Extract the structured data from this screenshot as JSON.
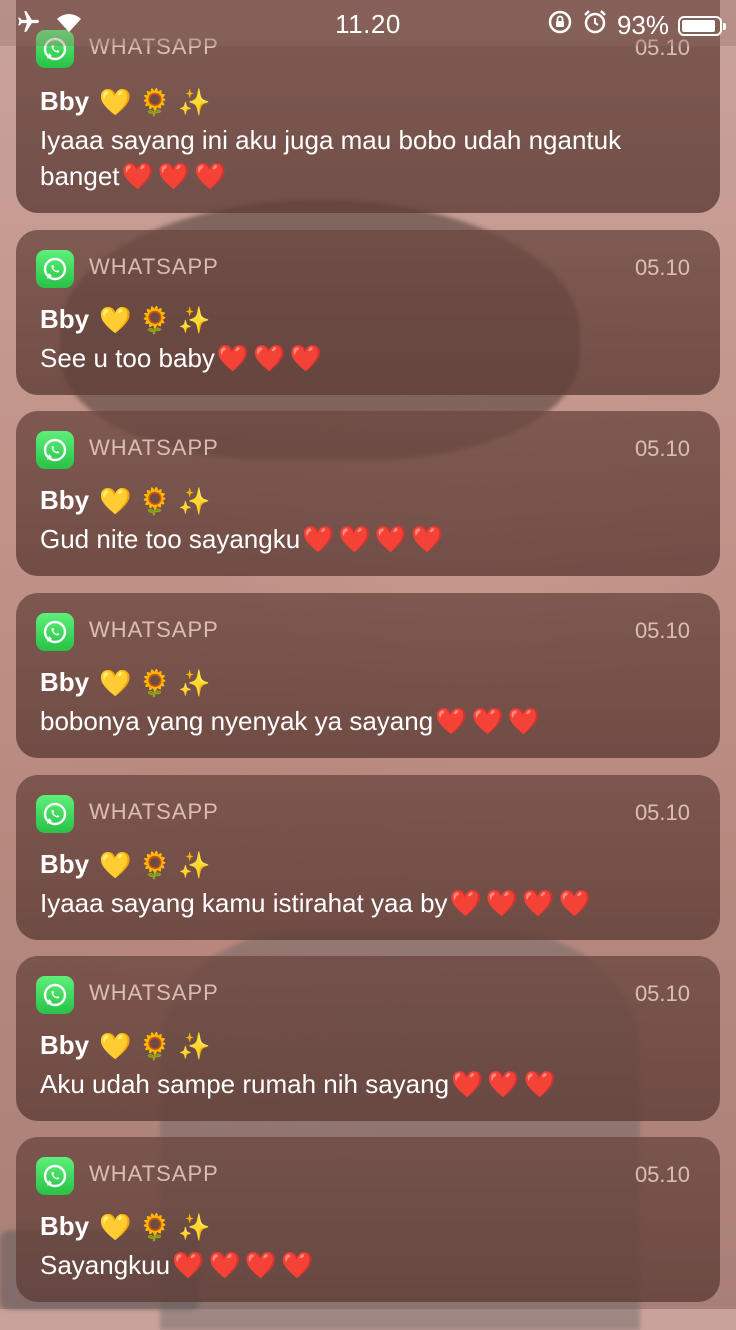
{
  "status_bar": {
    "time": "11.20",
    "battery_percent": "93%",
    "battery_level": 0.93,
    "icons": [
      "airplane-icon",
      "wifi-icon",
      "rotation-lock-icon",
      "alarm-icon",
      "battery-icon"
    ]
  },
  "notifications": [
    {
      "app": "WHATSAPP",
      "time": "05.10",
      "sender": "Bby",
      "sender_emoji": "💛 🌻 ✨",
      "message": "Iyaaa sayang ini aku juga mau bobo udah ngantuk banget",
      "hearts": "❤️❤️❤️"
    },
    {
      "app": "WHATSAPP",
      "time": "05.10",
      "sender": "Bby",
      "sender_emoji": "💛 🌻 ✨",
      "message": "See u too baby",
      "hearts": "❤️❤️❤️"
    },
    {
      "app": "WHATSAPP",
      "time": "05.10",
      "sender": "Bby",
      "sender_emoji": "💛 🌻 ✨",
      "message": "Gud nite too sayangku",
      "hearts": "❤️❤️❤️❤️"
    },
    {
      "app": "WHATSAPP",
      "time": "05.10",
      "sender": "Bby",
      "sender_emoji": "💛 🌻 ✨",
      "message": "bobonya yang nyenyak ya sayang",
      "hearts": "❤️❤️❤️"
    },
    {
      "app": "WHATSAPP",
      "time": "05.10",
      "sender": "Bby",
      "sender_emoji": "💛 🌻 ✨",
      "message": "Iyaaa sayang kamu istirahat yaa by",
      "hearts": "❤️❤️❤️❤️"
    },
    {
      "app": "WHATSAPP",
      "time": "05.10",
      "sender": "Bby",
      "sender_emoji": "💛 🌻 ✨",
      "message": "Aku udah sampe rumah nih sayang",
      "hearts": "❤️❤️❤️"
    },
    {
      "app": "WHATSAPP",
      "time": "05.10",
      "sender": "Bby",
      "sender_emoji": "💛 🌻 ✨",
      "message": "Sayangkuu",
      "hearts": "❤️❤️❤️❤️"
    }
  ]
}
